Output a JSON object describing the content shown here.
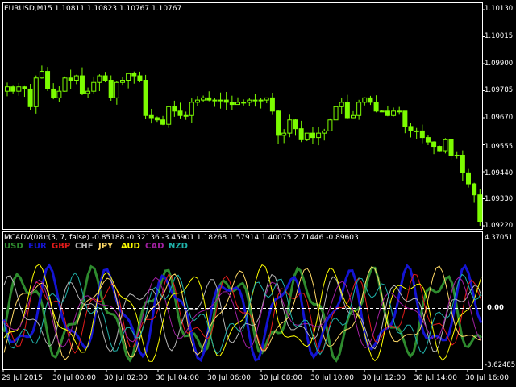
{
  "price_panel": {
    "symbol_timeframe": "EURUSD,M15",
    "ohlc": [
      "1.10811",
      "1.10823",
      "1.10767",
      "1.10767"
    ],
    "price_ticks": [
      "1.10130",
      "1.10015",
      "1.09900",
      "1.09785",
      "1.09670",
      "1.09555",
      "1.09440",
      "1.09330",
      "1.09220"
    ],
    "candle_colors": {
      "bull": "#000000",
      "outline": "#7cfc00"
    }
  },
  "indicator_panel": {
    "title": "MCADV(08):(3, 7, false)",
    "values": [
      "-0.85188",
      "-0.32136",
      "-3.45901",
      "1.18268",
      "1.57914",
      "1.40075",
      "2.71446",
      "-0.89603"
    ],
    "currencies": [
      {
        "name": "USD",
        "color": "#2e8b2e"
      },
      {
        "name": "EUR",
        "color": "#1414d2"
      },
      {
        "name": "GBP",
        "color": "#e41b1b"
      },
      {
        "name": "CHF",
        "color": "#b4b4b4"
      },
      {
        "name": "JPY",
        "color": "#ffd966"
      },
      {
        "name": "AUD",
        "color": "#ffff00"
      },
      {
        "name": "CAD",
        "color": "#a020a0"
      },
      {
        "name": "NZD",
        "color": "#20b2aa"
      }
    ],
    "max_label": "4.37051",
    "zero_label": "0.00",
    "min_label": "-3.62485"
  },
  "time_axis": [
    "29 Jul 2015",
    "30 Jul 00:00",
    "30 Jul 02:00",
    "30 Jul 04:00",
    "30 Jul 06:00",
    "30 Jul 08:00",
    "30 Jul 10:00",
    "30 Jul 12:00",
    "30 Jul 14:00",
    "30 Jul 16:00"
  ],
  "chart_data": {
    "type": "candlestick+lines",
    "price_range": [
      1.0918,
      1.1016
    ],
    "candles_close": [
      1.0981,
      1.0979,
      1.0981,
      1.098,
      1.0972,
      1.0985,
      1.0988,
      1.098,
      1.0976,
      1.0979,
      1.0985,
      1.0984,
      1.0986,
      1.0978,
      1.0979,
      1.0983,
      1.0986,
      1.0984,
      1.0976,
      1.0983,
      1.0984,
      1.0987,
      1.0986,
      1.0984,
      1.0968,
      1.0967,
      1.0966,
      1.0964,
      1.0972,
      1.097,
      1.0968,
      1.0968,
      1.0974,
      1.0975,
      1.0976,
      1.0975,
      1.0975,
      1.0975,
      1.0974,
      1.0973,
      1.0974,
      1.0974,
      1.0975,
      1.0975,
      1.0975,
      1.0976,
      1.097,
      1.0959,
      1.096,
      1.0966,
      1.0962,
      1.0957,
      1.096,
      1.0958,
      1.096,
      1.0961,
      1.0966,
      1.0972,
      1.0974,
      1.0967,
      1.0968,
      1.0974,
      1.0976,
      1.0974,
      1.097,
      1.097,
      1.0968,
      1.097,
      1.097,
      1.0963,
      1.0961,
      1.0961,
      1.0958,
      1.0956,
      1.0954,
      1.0952,
      1.0957,
      1.095,
      1.095,
      1.0942,
      1.0937,
      1.0932,
      1.092
    ],
    "indicator_range": [
      -3.62485,
      4.37051
    ]
  }
}
